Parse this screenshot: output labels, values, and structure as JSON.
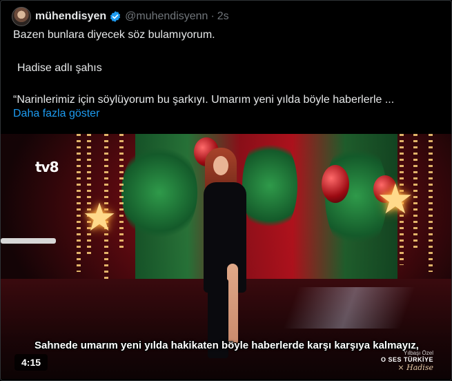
{
  "tweet": {
    "display_name": "mühendisyen",
    "handle": "@muhendisyenn",
    "separator": "·",
    "time": "2s",
    "lines": [
      "Bazen bunlara diyecek söz bulamıyorum.",
      "Hadise adlı şahıs",
      "“Narinlerimiz için söylüyorum bu şarkıyı. Umarım yeni yılda böyle haberlerle ..."
    ],
    "show_more": "Daha fazla göster"
  },
  "video": {
    "channel_logo": "tv8",
    "subtitle": "Sahnede umarım yeni yılda hakikaten böyle haberlerde karşı karşıya kalmayız,",
    "duration": "4:15",
    "watermark_line1": "Yılbaşı Özel",
    "watermark_line2": "O SES TÜRKİYE",
    "watermark_line3": "× Hadise"
  },
  "colors": {
    "background": "#000000",
    "text": "#e7e9ea",
    "secondary": "#71767b",
    "link": "#1d9bf0",
    "verified": "#1d9bf0"
  }
}
